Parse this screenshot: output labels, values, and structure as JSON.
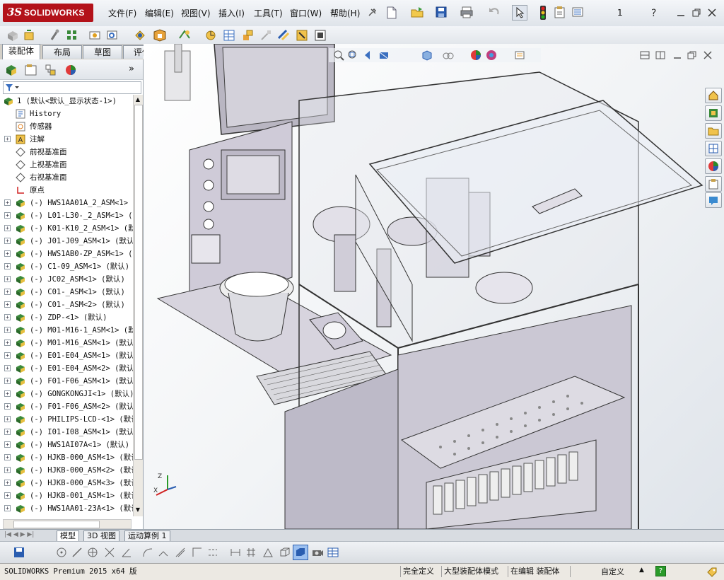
{
  "app": {
    "brand": "SOLIDWORKS",
    "ds_mark": "3S",
    "doc_number": "1"
  },
  "menu": [
    "文件(F)",
    "编辑(E)",
    "视图(V)",
    "插入(I)",
    "工具(T)",
    "窗口(W)",
    "帮助(H)"
  ],
  "command_tabs": [
    "装配体",
    "布局",
    "草图",
    "评估"
  ],
  "tree": {
    "root": "1  (默认<默认_显示状态-1>)",
    "items": [
      {
        "label": "History",
        "icon": "history-icon",
        "expand": false
      },
      {
        "label": "传感器",
        "icon": "sensor-icon",
        "expand": false
      },
      {
        "label": "注解",
        "icon": "annotation-icon",
        "expand": true
      },
      {
        "label": "前视基准面",
        "icon": "plane-icon",
        "expand": false
      },
      {
        "label": "上视基准面",
        "icon": "plane-icon",
        "expand": false
      },
      {
        "label": "右视基准面",
        "icon": "plane-icon",
        "expand": false
      },
      {
        "label": "原点",
        "icon": "origin-icon",
        "expand": false
      },
      {
        "label": "(-) HWS1AA01A_2_ASM<1> (",
        "icon": "assembly-icon",
        "expand": true
      },
      {
        "label": "(-) L01-L30-_2_ASM<1> (",
        "icon": "assembly-icon",
        "expand": true
      },
      {
        "label": "(-) K01-K10_2_ASM<1> (默",
        "icon": "assembly-icon",
        "expand": true
      },
      {
        "label": "(-) J01-J09_ASM<1> (默认",
        "icon": "assembly-icon",
        "expand": true
      },
      {
        "label": "(-) HWS1AB0-ZP_ASM<1> (",
        "icon": "assembly-icon",
        "expand": true
      },
      {
        "label": "(-) C1-09_ASM<1> (默认)",
        "icon": "assembly-icon",
        "expand": true
      },
      {
        "label": "(-) JC02_ASM<1> (默认)",
        "icon": "assembly-icon",
        "expand": true
      },
      {
        "label": "(-) C01-_ASM<1> (默认)",
        "icon": "assembly-icon",
        "expand": true
      },
      {
        "label": "(-) C01-_ASM<2> (默认)",
        "icon": "assembly-icon",
        "expand": true
      },
      {
        "label": "(-) ZDP-<1> (默认)",
        "icon": "assembly-icon",
        "expand": true
      },
      {
        "label": "(-) M01-M16-1_ASM<1> (默",
        "icon": "assembly-icon",
        "expand": true
      },
      {
        "label": "(-) M01-M16_ASM<1> (默认",
        "icon": "assembly-icon",
        "expand": true
      },
      {
        "label": "(-) E01-E04_ASM<1> (默认",
        "icon": "assembly-icon",
        "expand": true
      },
      {
        "label": "(-) E01-E04_ASM<2> (默认",
        "icon": "assembly-icon",
        "expand": true
      },
      {
        "label": "(-) F01-F06_ASM<1> (默认",
        "icon": "assembly-icon",
        "expand": true
      },
      {
        "label": "(-) GONGKONGJI<1> (默认)",
        "icon": "assembly-icon",
        "expand": true
      },
      {
        "label": "(-) F01-F06_ASM<2> (默认",
        "icon": "assembly-icon",
        "expand": true
      },
      {
        "label": "(-) PHILIPS-LCD-<1> (默认",
        "icon": "assembly-icon",
        "expand": true
      },
      {
        "label": "(-) I01-I08_ASM<1> (默认",
        "icon": "assembly-icon",
        "expand": true
      },
      {
        "label": "(-) HWS1AI07A<1> (默认)",
        "icon": "assembly-icon",
        "expand": true
      },
      {
        "label": "(-) HJKB-000_ASM<1> (默认",
        "icon": "assembly-icon",
        "expand": true
      },
      {
        "label": "(-) HJKB-000_ASM<2> (默认",
        "icon": "assembly-icon",
        "expand": true
      },
      {
        "label": "(-) HJKB-000_ASM<3> (默认",
        "icon": "assembly-icon",
        "expand": true
      },
      {
        "label": "(-) HJKB-001_ASM<1> (默认",
        "icon": "assembly-icon",
        "expand": true
      },
      {
        "label": "(-) HWS1AA01-23A<1> (默认",
        "icon": "assembly-icon",
        "expand": true
      }
    ]
  },
  "bottom_tabs": [
    "模型",
    "3D 视图",
    "运动算例 1"
  ],
  "status": {
    "product": "SOLIDWORKS Premium 2015 x64 版",
    "definition": "完全定义",
    "mode": "大型装配体模式",
    "editing": "在编辑 装配体",
    "units": "自定义"
  },
  "colors": {
    "brand_red": "#b3121a",
    "viewport_bg": "#eef1f4",
    "machine_frame": "#c9c6d3"
  }
}
